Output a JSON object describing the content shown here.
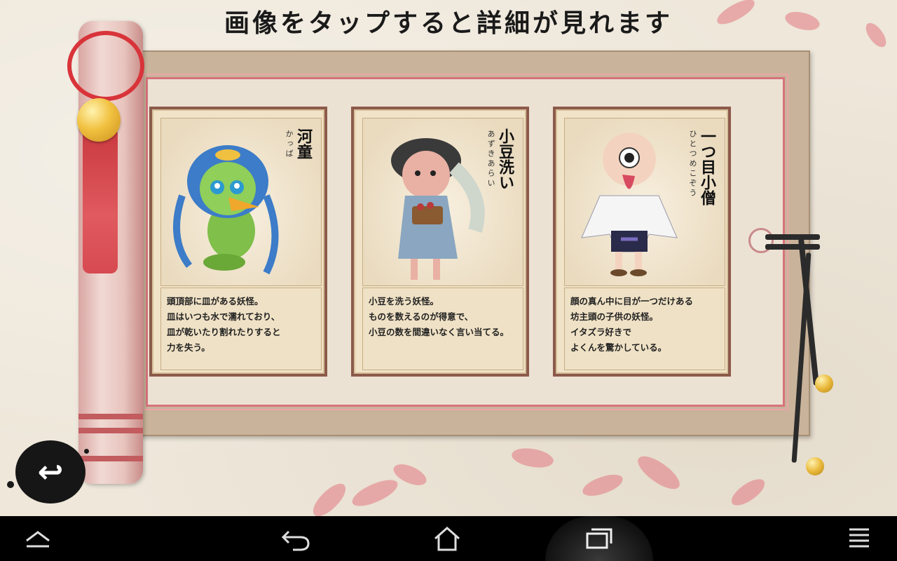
{
  "header": {
    "title": "画像をタップすると詳細が見れます"
  },
  "cards": [
    {
      "name": "河童",
      "reading": "かっぱ",
      "description": "頭頂部に皿がある妖怪。\n皿はいつも水で濡れており、\n皿が乾いたり割れたりすると\n力を失う。"
    },
    {
      "name": "小豆洗い",
      "reading": "あずきあらい",
      "description": "小豆を洗う妖怪。\nものを数えるのが得意で、\n小豆の数を間違いなく言い当てる。"
    },
    {
      "name": "一つ目小僧",
      "reading": "ひとつめこぞう",
      "description": "顔の真ん中に目が一つだけある\n坊主頭の子供の妖怪。\nイタズラ好きで\nよくんを驚かしている。"
    }
  ],
  "back_button": {
    "icon": "return-arrow-icon",
    "glyph": "↩"
  },
  "navbar": {
    "items": [
      "up-chevron-icon",
      "back-icon",
      "home-icon",
      "recents-icon",
      "menu-icon"
    ]
  },
  "colors": {
    "board": "#c9b39a",
    "frame_accent": "#d7737c",
    "card_border": "#8c5a4a",
    "navbar": "#000000"
  }
}
